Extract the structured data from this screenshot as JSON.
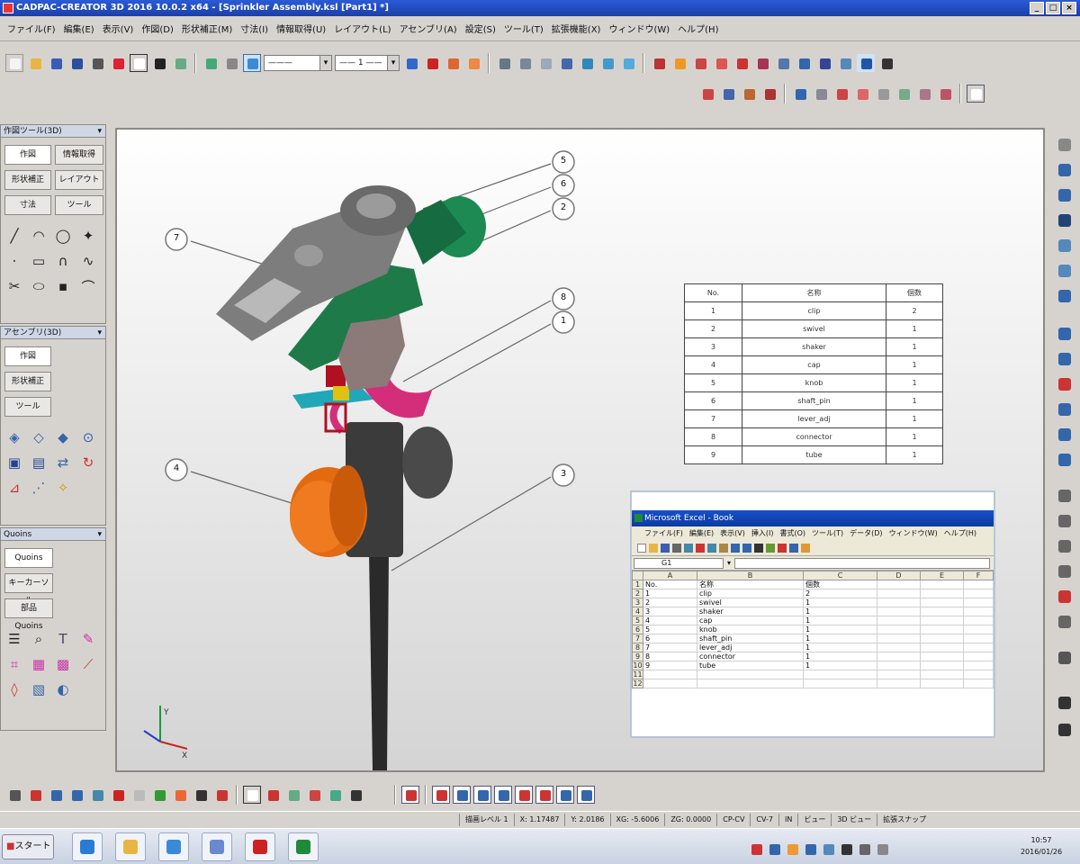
{
  "window": {
    "title": "CADPAC-CREATOR 3D 2016 10.0.2 x64 - [Sprinkler Assembly.ksl [Part1] *]"
  },
  "menu": [
    "ファイル(F)",
    "編集(E)",
    "表示(V)",
    "作図(D)",
    "形状補正(M)",
    "寸法(I)",
    "情報取得(U)",
    "レイアウト(L)",
    "アセンブリ(A)",
    "設定(S)",
    "ツール(T)",
    "拡張機能(X)",
    "ウィンドウ(W)",
    "ヘルプ(H)"
  ],
  "toolbar": {
    "linetype_value": "———",
    "linewidth_value": "—— 1 ——"
  },
  "left_panel": {
    "panel1_title": "作図ツール(3D)",
    "panel1_buttons": [
      "作図",
      "情報取得",
      "形状補正",
      "レイアウト",
      "寸法",
      "ツール"
    ],
    "panel2_title": "アセンブリ(3D)",
    "panel2_buttons": [
      "作図",
      "形状補正",
      "ツール"
    ],
    "panel3_title": "Quoins",
    "panel3_buttons": [
      "Quoins",
      "キーカーソル",
      "部品 Quoins"
    ]
  },
  "balloons": [
    "5",
    "6",
    "2",
    "7",
    "8",
    "1",
    "4",
    "3"
  ],
  "bom": {
    "headers": [
      "No.",
      "名称",
      "個数"
    ],
    "rows": [
      [
        "1",
        "clip",
        "2"
      ],
      [
        "2",
        "swivel",
        "1"
      ],
      [
        "3",
        "shaker",
        "1"
      ],
      [
        "4",
        "cap",
        "1"
      ],
      [
        "5",
        "knob",
        "1"
      ],
      [
        "6",
        "shaft_pin",
        "1"
      ],
      [
        "7",
        "lever_adj",
        "1"
      ],
      [
        "8",
        "connector",
        "1"
      ],
      [
        "9",
        "tube",
        "1"
      ]
    ]
  },
  "excel": {
    "title": "Microsoft Excel - Book",
    "menu": [
      "ファイル(F)",
      "編集(E)",
      "表示(V)",
      "挿入(I)",
      "書式(O)",
      "ツール(T)",
      "データ(D)",
      "ウィンドウ(W)",
      "ヘルプ(H)"
    ],
    "name_box": "G1",
    "col_headers": [
      "",
      "A",
      "B",
      "C",
      "D",
      "E",
      "F"
    ],
    "rows": [
      [
        "1",
        "No.",
        "名称",
        "個数",
        "",
        "",
        ""
      ],
      [
        "2",
        "1",
        "clip",
        "2",
        "",
        "",
        ""
      ],
      [
        "3",
        "2",
        "swivel",
        "1",
        "",
        "",
        ""
      ],
      [
        "4",
        "3",
        "shaker",
        "1",
        "",
        "",
        ""
      ],
      [
        "5",
        "4",
        "cap",
        "1",
        "",
        "",
        ""
      ],
      [
        "6",
        "5",
        "knob",
        "1",
        "",
        "",
        ""
      ],
      [
        "7",
        "6",
        "shaft_pin",
        "1",
        "",
        "",
        ""
      ],
      [
        "8",
        "7",
        "lever_adj",
        "1",
        "",
        "",
        ""
      ],
      [
        "9",
        "8",
        "connector",
        "1",
        "",
        "",
        ""
      ],
      [
        "10",
        "9",
        "tube",
        "1",
        "",
        "",
        ""
      ],
      [
        "11",
        "",
        "",
        "",
        "",
        "",
        ""
      ],
      [
        "12",
        "",
        "",
        "",
        "",
        "",
        ""
      ]
    ]
  },
  "status": [
    "描画レベル 1",
    "X: 1.17487",
    "Y: 2.0186",
    "XG: -5.6006",
    "ZG: 0.0000",
    "CP-CV",
    "CV-7",
    "IN",
    "ビュー",
    "3D ビュー",
    "拡張スナップ"
  ],
  "taskbar": {
    "start_label": "スタート",
    "clock_time": "10:57",
    "clock_date": "2016/01/26"
  },
  "axis_labels": {
    "y": "Y",
    "x": "X"
  }
}
